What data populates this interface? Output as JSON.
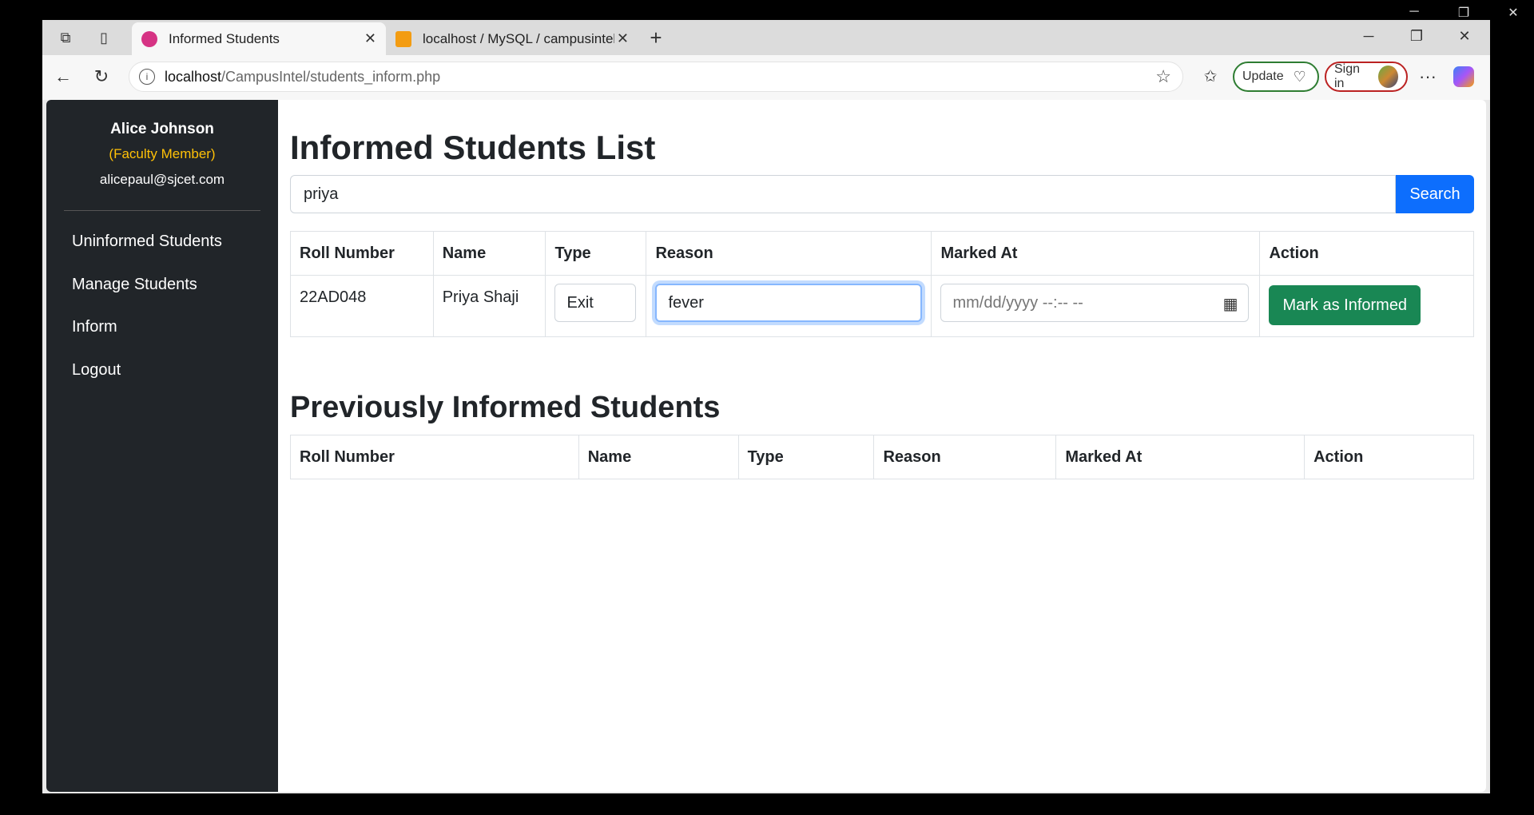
{
  "os": {
    "minimize": "─",
    "restore": "❐",
    "close": "✕"
  },
  "browser": {
    "tabs": [
      {
        "title": "Informed Students",
        "close": "✕"
      },
      {
        "title": "localhost / MySQL / campusintel /",
        "close": "✕"
      }
    ],
    "new_tab": "+",
    "window_controls": {
      "minimize": "─",
      "restore": "❐",
      "close": "✕"
    },
    "url_host": "localhost",
    "url_path": "/CampusIntel/students_inform.php",
    "update_label": "Update",
    "signin_label": "Sign in",
    "more": "···"
  },
  "sidebar": {
    "user_name": "Alice Johnson",
    "user_role": "(Faculty Member)",
    "user_email": "alicepaul@sjcet.com",
    "links": [
      "Uninformed Students",
      "Manage Students",
      "Inform",
      "Logout"
    ]
  },
  "main": {
    "title": "Informed Students List",
    "search_value": "priya",
    "search_button": "Search",
    "table_headers": [
      "Roll Number",
      "Name",
      "Type",
      "Reason",
      "Marked At",
      "Action"
    ],
    "rows": [
      {
        "roll": "22AD048",
        "name": "Priya Shaji",
        "type": "Exit",
        "reason": "fever",
        "marked_at_placeholder": "mm/dd/yyyy --:-- --",
        "action": "Mark as Informed"
      }
    ],
    "previous_title": "Previously Informed Students",
    "previous_headers": [
      "Roll Number",
      "Name",
      "Type",
      "Reason",
      "Marked At",
      "Action"
    ]
  },
  "colors": {
    "sidebar_bg": "#212529",
    "role_color": "#ffc107",
    "search_btn": "#0d6efd",
    "action_btn": "#198754"
  }
}
